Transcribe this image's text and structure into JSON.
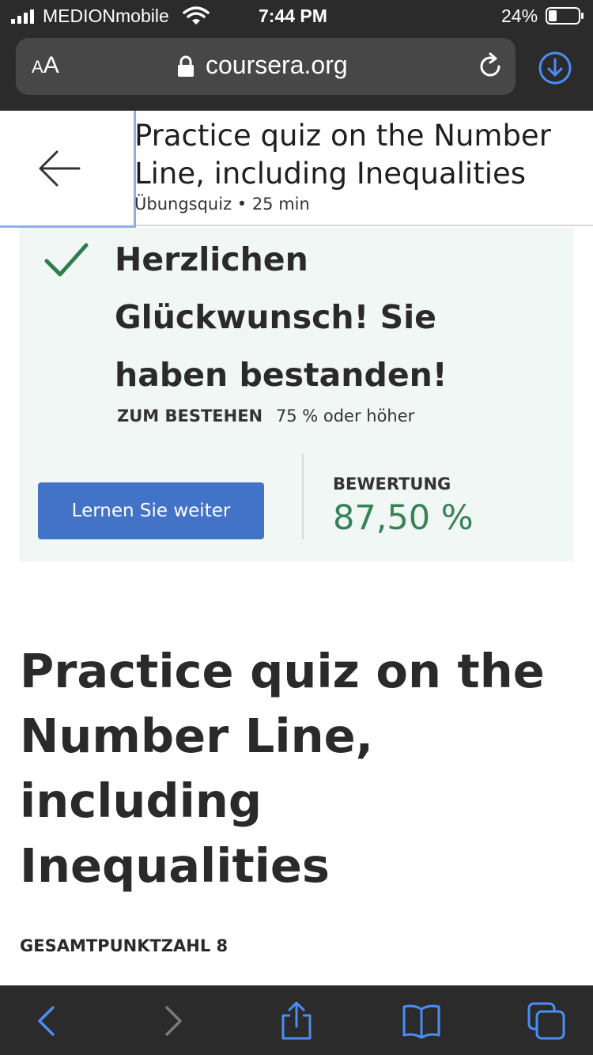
{
  "status_bar": {
    "carrier": "MEDIONmobile",
    "time": "7:44 PM",
    "battery": "24%"
  },
  "browser": {
    "text_size_small": "A",
    "text_size_big": "A",
    "url": "coursera.org",
    "icons": {
      "lock": "lock-icon",
      "reload": "reload-icon",
      "download": "download-icon"
    }
  },
  "header": {
    "title": "Practice quiz on the Number Line, including Inequalities",
    "subtitle": "Übungsquiz • 25 min"
  },
  "result": {
    "heading": "Herzlichen Glückwunsch! Sie haben bestanden!",
    "pass_label": "ZUM BESTEHEN",
    "pass_value": "75 % oder höher",
    "continue_button": "Lernen Sie weiter",
    "grade_label": "BEWERTUNG",
    "grade_value": "87,50 %",
    "colors": {
      "accent_button": "#4373c7",
      "grade_green": "#368355",
      "check_green": "#2f7d4f"
    }
  },
  "main": {
    "title": "Practice quiz on the Number Line, including Inequalities",
    "total_points": "GESAMTPUNKTZAHL 8"
  },
  "toolbar": {
    "icons": [
      "back-icon",
      "forward-icon",
      "share-icon",
      "bookmarks-icon",
      "tabs-icon"
    ],
    "accent": "#4a8ef5",
    "disabled": "#7a7a7a"
  }
}
